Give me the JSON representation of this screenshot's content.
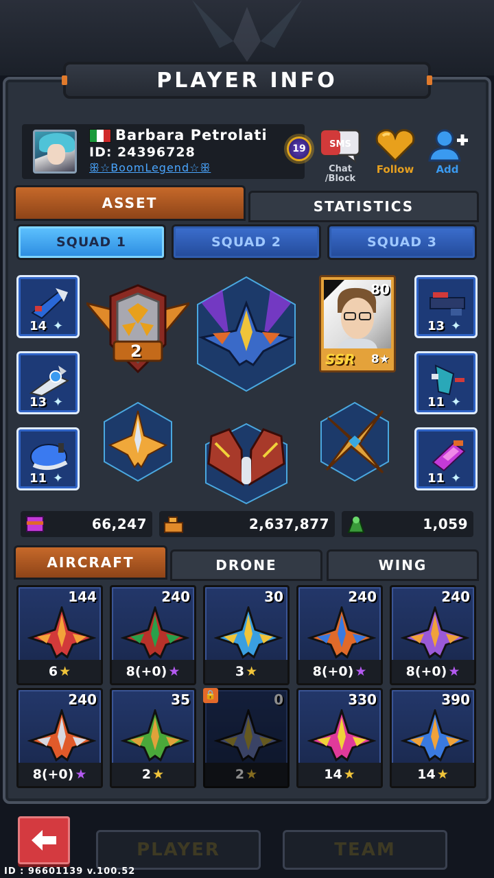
{
  "header": {
    "title": "PLAYER INFO"
  },
  "profile": {
    "flag_colors": [
      "#1a9a3a",
      "#ffffff",
      "#d02a2a"
    ],
    "name": "Barbara Petrolati",
    "id_text": "ID: 24396728",
    "tag": "ꕥ☆BoomLegend☆ꕥ",
    "level": "19"
  },
  "actions": {
    "chat": "Chat\n/Block",
    "follow": "Follow",
    "add": "Add"
  },
  "main_tabs": {
    "asset": "ASSET",
    "statistics": "STATISTICS",
    "active": "asset"
  },
  "squads": [
    {
      "label": "SQUAD 1",
      "active": true
    },
    {
      "label": "SQUAD 2",
      "active": false
    },
    {
      "label": "SQUAD 3",
      "active": false
    }
  ],
  "left_slots": [
    {
      "level": "14",
      "icon": "missile-launcher-icon"
    },
    {
      "level": "13",
      "icon": "plasma-blaster-icon"
    },
    {
      "level": "11",
      "icon": "ice-cannon-icon"
    }
  ],
  "right_slots": [
    {
      "level": "13",
      "icon": "heavy-gun-icon"
    },
    {
      "level": "11",
      "icon": "wing-gun-icon"
    },
    {
      "level": "11",
      "icon": "crystal-launcher-icon"
    }
  ],
  "rank_badge": {
    "value": "2"
  },
  "pilot": {
    "level": "80",
    "rank": "SSR",
    "stars": "8★"
  },
  "resources": [
    {
      "icon": "gem-crate-icon",
      "value": "66,247"
    },
    {
      "icon": "gold-stack-icon",
      "value": "2,637,877"
    },
    {
      "icon": "green-part-icon",
      "value": "1,059"
    }
  ],
  "sub_tabs": {
    "aircraft": "AIRCRAFT",
    "drone": "DRONE",
    "wing": "WING",
    "active": "aircraft"
  },
  "aircraft": [
    {
      "level": "144",
      "stars": "6",
      "star_type": "gold",
      "colors": [
        "#d23a3a",
        "#f3a33a"
      ]
    },
    {
      "level": "240",
      "stars": "8(+0)",
      "star_type": "purple",
      "colors": [
        "#b8322a",
        "#2aa04a"
      ]
    },
    {
      "level": "30",
      "stars": "3",
      "star_type": "gold",
      "colors": [
        "#3a9fe0",
        "#f0c43a"
      ]
    },
    {
      "level": "240",
      "stars": "8(+0)",
      "star_type": "purple",
      "colors": [
        "#e06a2a",
        "#3a7ae0"
      ]
    },
    {
      "level": "240",
      "stars": "8(+0)",
      "star_type": "purple",
      "colors": [
        "#9a5ad8",
        "#f0a23a"
      ]
    },
    {
      "level": "240",
      "stars": "8(+0)",
      "star_type": "purple",
      "colors": [
        "#e05a2a",
        "#d8d8e0"
      ]
    },
    {
      "level": "35",
      "stars": "2",
      "star_type": "gold",
      "colors": [
        "#4aa83a",
        "#e0a23a"
      ]
    },
    {
      "level": "0",
      "stars": "2",
      "star_type": "gold",
      "colors": [
        "#6a7ab8",
        "#b8a23a"
      ],
      "locked": true
    },
    {
      "level": "330",
      "stars": "14",
      "star_type": "gold",
      "colors": [
        "#e03a9a",
        "#f0d23a"
      ]
    },
    {
      "level": "390",
      "stars": "14",
      "star_type": "gold",
      "colors": [
        "#3a7ae0",
        "#f0a23a"
      ]
    }
  ],
  "bottom": {
    "player_tab": "PLAYER",
    "team_tab": "TEAM",
    "version": "ID : 96601139 v.100.52"
  },
  "bg_ghost": {
    "left": "",
    "right": ""
  }
}
